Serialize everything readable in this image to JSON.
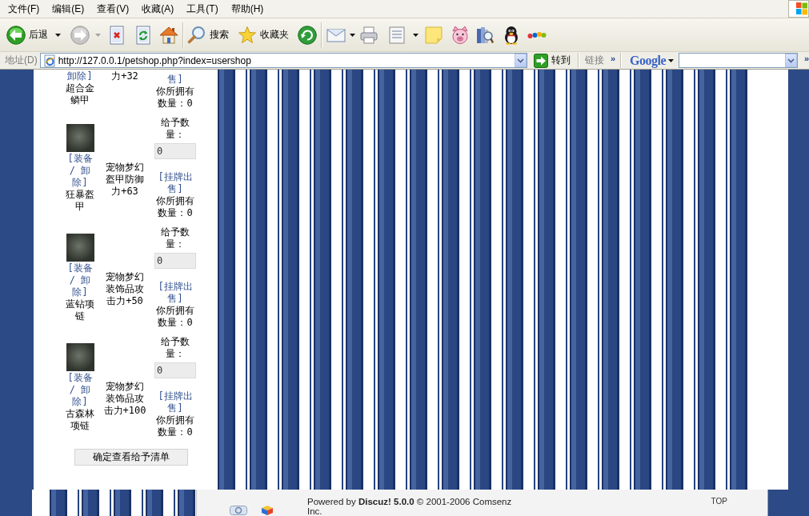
{
  "menu_bar": {
    "items": [
      "文件(F)",
      "编辑(E)",
      "查看(V)",
      "收藏(A)",
      "工具(T)",
      "帮助(H)"
    ]
  },
  "toolbar": {
    "back": {
      "label": "后退"
    },
    "forward": {
      "disabled": true
    },
    "search": {
      "label": "搜索"
    },
    "favorites": {
      "label": "收藏夹"
    }
  },
  "address_bar": {
    "label": "地址(D)",
    "url": "http://127.0.0.1/petshop.php?index=usershop",
    "go_button": "转到",
    "links_label": "链接",
    "links_more": "»"
  },
  "google_toolbar": {
    "logo": "Google",
    "more": "»"
  },
  "shop": {
    "items": [
      {
        "kind": "cut",
        "link": "卸除]",
        "name": "超合金鳞甲",
        "description": "力+32",
        "sell_link": "售]",
        "owned": "你所拥有数量：0"
      },
      {
        "kind": "full",
        "link": "[装备 / 卸除]",
        "name": "狂暴盔甲",
        "description": "宠物梦幻盔甲防御力+63",
        "quantity_label": "给予数量：",
        "quantity": "0",
        "sell_link": "[挂牌出售]",
        "owned": "你所拥有数量：0"
      },
      {
        "kind": "full",
        "link": "[装备 / 卸除]",
        "name": "蓝钻项链",
        "description": "宠物梦幻装饰品攻击力+50",
        "quantity_label": "给予数量：",
        "quantity": "0",
        "sell_link": "[挂牌出售]",
        "owned": "你所拥有数量：0"
      },
      {
        "kind": "full",
        "link": "[装备 / 卸除]",
        "name": "古森林项链",
        "description": "宠物梦幻装饰品攻击力+100",
        "quantity_label": "给予数量：",
        "quantity": "0",
        "sell_link": "[挂牌出售]",
        "owned": "你所拥有数量：0"
      }
    ],
    "confirm_button": "确定查看给予清单"
  },
  "footer": {
    "powered_by": "Powered by **Discuz!** **5.0.0** © 2001-2006 Comsenz Inc.",
    "top_link": "TOP"
  }
}
